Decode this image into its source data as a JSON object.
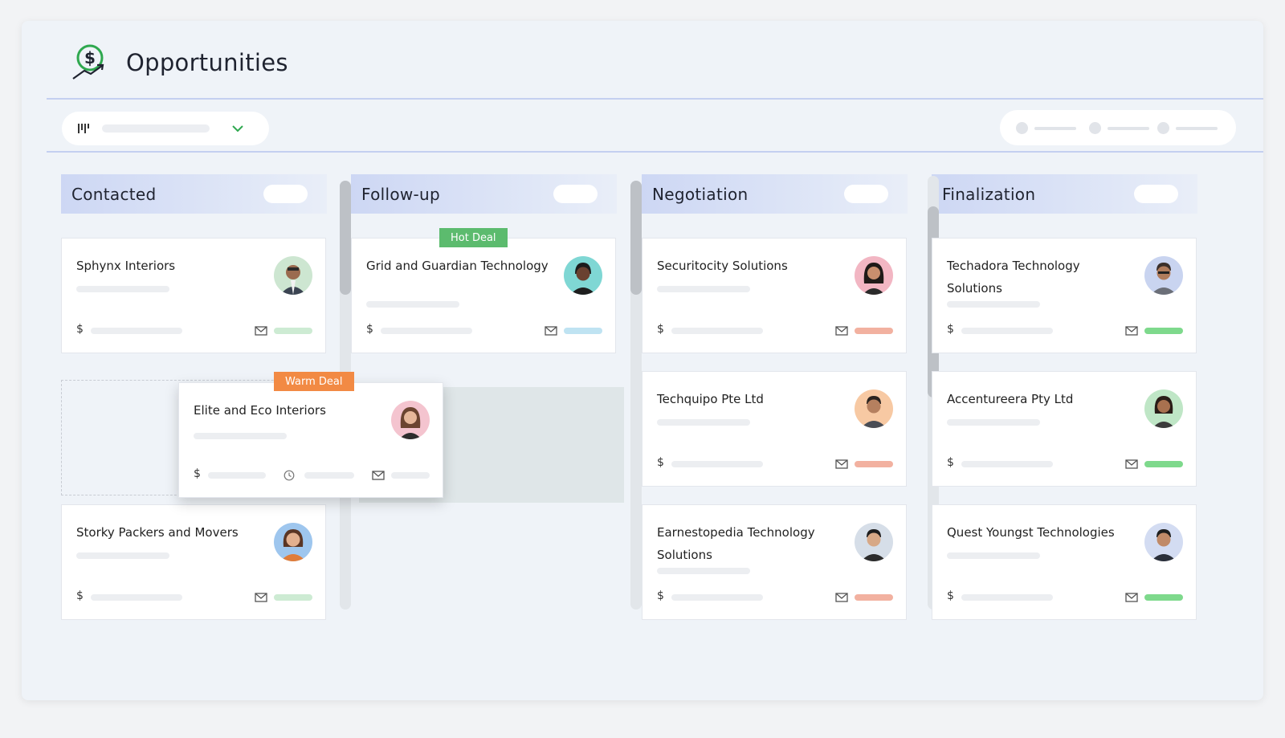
{
  "page": {
    "title": "Opportunities"
  },
  "colors": {
    "accent_green": "#2fa84f",
    "hot_tag": "#5cbb6e",
    "warm_tag": "#f28a44",
    "status_green": "#7ed98c",
    "status_light_green": "#cdebd3",
    "status_blue": "#bfe3f2",
    "status_salmon": "#f2b1a0"
  },
  "toolbar": {
    "view_icon": "kanban-icon",
    "dropdown_icon": "chevron-down-icon"
  },
  "columns": [
    {
      "title": "Contacted",
      "cards": [
        {
          "name": "Sphynx Interiors",
          "currency": "$"
        },
        {
          "name": "Storky Packers and Movers",
          "currency": "$"
        }
      ]
    },
    {
      "title": "Follow-up",
      "cards": [
        {
          "name": "Grid and Guardian Technology",
          "currency": "$",
          "tag": "Hot Deal"
        }
      ]
    },
    {
      "title": "Negotiation",
      "cards": [
        {
          "name": "Securitocity Solutions",
          "currency": "$"
        },
        {
          "name": "Techquipo Pte Ltd",
          "currency": "$"
        },
        {
          "name": "Earnestopedia Technology Solutions",
          "currency": "$"
        }
      ]
    },
    {
      "title": "Finalization",
      "cards": [
        {
          "name": "Techadora Technology Solutions",
          "currency": "$"
        },
        {
          "name": "Accentureera Pty Ltd",
          "currency": "$"
        },
        {
          "name": "Quest Youngst Technologies",
          "currency": "$"
        }
      ]
    }
  ],
  "dragged_card": {
    "name": "Elite and Eco Interiors",
    "currency": "$",
    "tag": "Warm Deal",
    "time_icon": "clock-icon"
  }
}
